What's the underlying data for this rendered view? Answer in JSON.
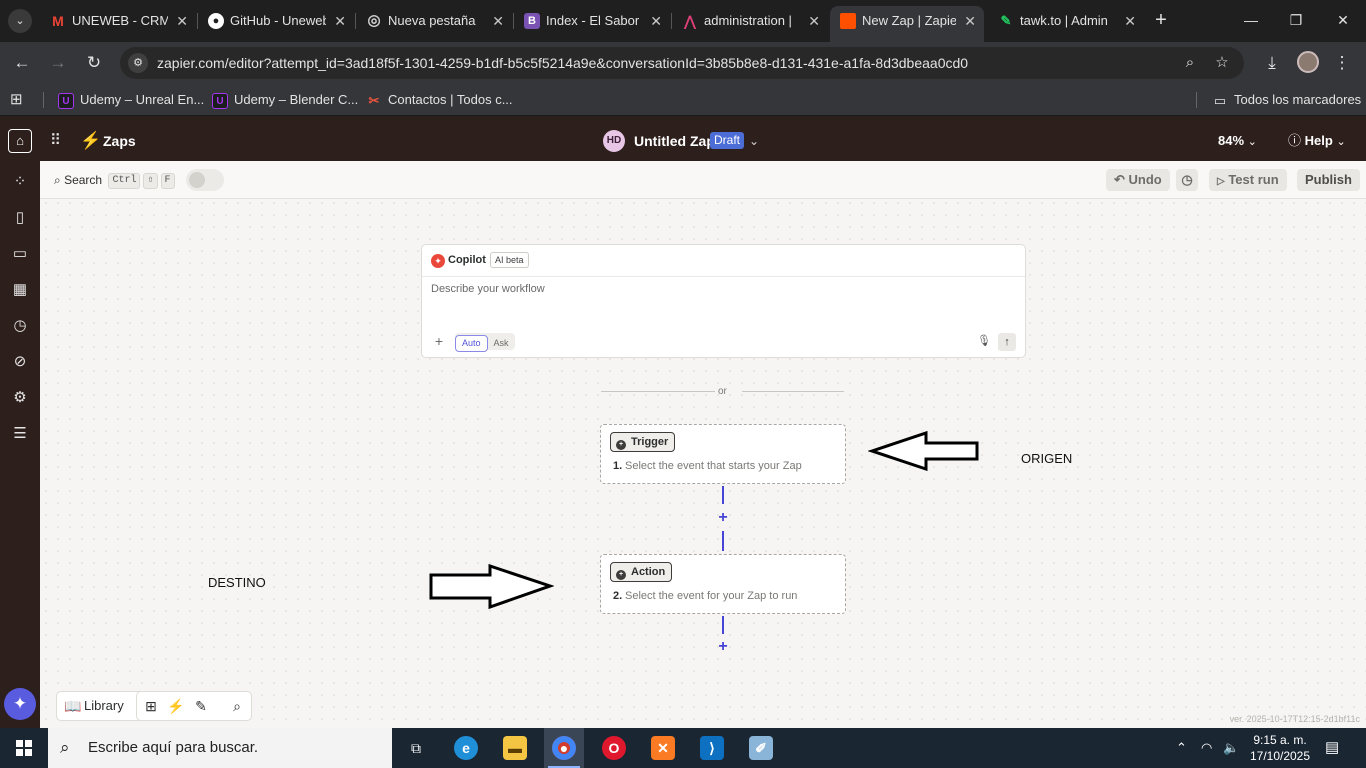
{
  "browser": {
    "tabs": [
      {
        "title": "UNEWEB - CRM",
        "icon": "gmail-icon",
        "color": "#ea4335",
        "glyph": "M"
      },
      {
        "title": "GitHub - Uneweb",
        "icon": "github-icon",
        "color": "#ffffff",
        "glyph": "●"
      },
      {
        "title": "Nueva pestaña",
        "icon": "chrome-icon",
        "color": "#bdbdbd",
        "glyph": "◎"
      },
      {
        "title": "Index - El Sabor",
        "icon": "bootstrap-icon",
        "color": "#7952b3",
        "glyph": "B"
      },
      {
        "title": "administration |",
        "icon": "admin-icon",
        "color": "#e0407a",
        "glyph": "⋀"
      },
      {
        "title": "New Zap | Zapier",
        "icon": "zapier-icon",
        "color": "#ff4f00",
        "glyph": ""
      },
      {
        "title": "tawk.to | Admin",
        "icon": "tawk-icon",
        "color": "#22c55e",
        "glyph": "✎"
      }
    ],
    "url": "zapier.com/editor?attempt_id=3ad18f5f-1301-4259-b1df-b5c5f5214a9e&conversationId=3b85b8e8-d131-431e-a1fa-8d3dbeaa0cd0",
    "bookmarks": [
      {
        "label": "Udemy – Unreal En...",
        "icon": "udemy-icon"
      },
      {
        "label": "Udemy – Blender C...",
        "icon": "udemy-icon"
      },
      {
        "label": "Contactos | Todos c...",
        "icon": "contacts-icon"
      }
    ],
    "all_bookmarks": "Todos los marcadores"
  },
  "zapier": {
    "section": "Zaps",
    "avatar_initials": "HD",
    "zap_name": "Untitled Zap",
    "status_badge": "Draft",
    "zoom": "84%",
    "help": "Help",
    "search_label": "Search",
    "shortcut_keys": [
      "Ctrl",
      "⇧",
      "F"
    ],
    "undo": "Undo",
    "test_run": "Test run",
    "publish": "Publish",
    "copilot": {
      "title": "Copilot",
      "badge": "AI beta",
      "placeholder": "Describe your workflow",
      "modes": [
        "Auto",
        "Ask"
      ],
      "selected_mode": "Auto"
    },
    "divider": "or",
    "trigger": {
      "badge": "Trigger",
      "number": "1.",
      "description": "Select the event that starts your Zap"
    },
    "action": {
      "badge": "Action",
      "number": "2.",
      "description": "Select the event for your Zap to run"
    },
    "library": "Library",
    "version": "ver. 2025-10-17T12:15-2d1bf11c"
  },
  "annotations": {
    "origin": "ORIGEN",
    "destination": "DESTINO"
  },
  "taskbar": {
    "search_placeholder": "Escribe aquí para buscar.",
    "time": "9:15 a. m.",
    "date": "17/10/2025"
  },
  "colors": {
    "zapier_orange": "#ff4f00",
    "connector": "#4744d6",
    "draft_badge": "#4c6cd6"
  }
}
